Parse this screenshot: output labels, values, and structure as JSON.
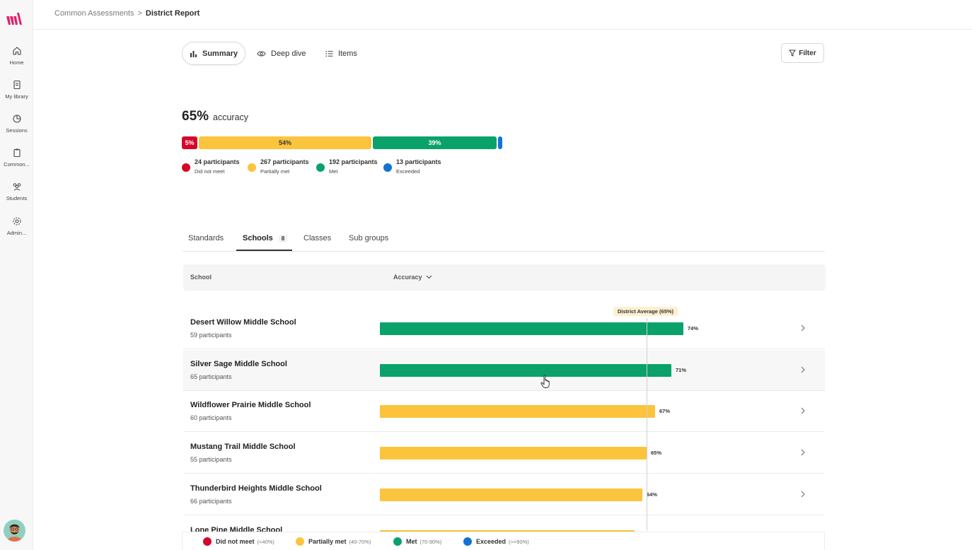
{
  "colors": {
    "did_not_meet": "#d6062b",
    "partially_met": "#fbc43c",
    "met": "#0aa26a",
    "exceeded": "#1173d4",
    "brand": "#e4206b"
  },
  "sidebar": {
    "items": [
      {
        "label": "Home",
        "icon": "home-icon"
      },
      {
        "label": "My library",
        "icon": "library-icon"
      },
      {
        "label": "Sessions",
        "icon": "sessions-icon"
      },
      {
        "label": "Common...",
        "icon": "clipboard-icon"
      },
      {
        "label": "Students",
        "icon": "students-icon"
      },
      {
        "label": "Admin...",
        "icon": "gear-icon"
      }
    ]
  },
  "breadcrumb": {
    "parent": "Common Assessments",
    "separator": ">",
    "current": "District Report"
  },
  "view_tabs": [
    {
      "label": "Summary",
      "icon": "bar-chart-icon",
      "active": true
    },
    {
      "label": "Deep dive",
      "icon": "eye-icon",
      "active": false
    },
    {
      "label": "Items",
      "icon": "list-icon",
      "active": false
    }
  ],
  "filter_label": "Filter",
  "accuracy": {
    "value": "65%",
    "label": "accuracy"
  },
  "distribution": [
    {
      "key": "did_not_meet",
      "percent": 5,
      "percent_label": "5%",
      "count_label": "24 participants",
      "category": "Did not meet"
    },
    {
      "key": "partially_met",
      "percent": 54,
      "percent_label": "54%",
      "count_label": "267 participants",
      "category": "Partially met"
    },
    {
      "key": "met",
      "percent": 39,
      "percent_label": "39%",
      "count_label": "192 participants",
      "category": "Met"
    },
    {
      "key": "exceeded",
      "percent": 2,
      "percent_label": "",
      "count_label": "13 participants",
      "category": "Exceeded"
    }
  ],
  "section_tabs": [
    {
      "label": "Standards",
      "active": false
    },
    {
      "label": "Schools",
      "active": true,
      "badge": "8"
    },
    {
      "label": "Classes",
      "active": false
    },
    {
      "label": "Sub groups",
      "active": false
    }
  ],
  "table": {
    "col_school": "School",
    "col_accuracy": "Accuracy",
    "district_average_label": "District Average (65%)",
    "district_average": 65,
    "rows": [
      {
        "name": "Desert Willow Middle School",
        "participants": "59 participants",
        "accuracy": 74,
        "accuracy_label": "74%",
        "level": "met"
      },
      {
        "name": "Silver Sage Middle School",
        "participants": "65 participants",
        "accuracy": 71,
        "accuracy_label": "71%",
        "level": "met"
      },
      {
        "name": "Wildflower Prairie Middle School",
        "participants": "60 participants",
        "accuracy": 67,
        "accuracy_label": "67%",
        "level": "partially_met"
      },
      {
        "name": "Mustang Trail Middle School",
        "participants": "55 participants",
        "accuracy": 65,
        "accuracy_label": "65%",
        "level": "partially_met"
      },
      {
        "name": "Thunderbird Heights Middle School",
        "participants": "66 participants",
        "accuracy": 64,
        "accuracy_label": "64%",
        "level": "partially_met"
      },
      {
        "name": "Lone Pine Middle School",
        "participants": "",
        "accuracy": 62,
        "accuracy_label": "",
        "level": "partially_met"
      }
    ]
  },
  "bottom_legend": [
    {
      "key": "did_not_meet",
      "label": "Did not meet",
      "range": "(<40%)"
    },
    {
      "key": "partially_met",
      "label": "Partially met",
      "range": "(40-70%)"
    },
    {
      "key": "met",
      "label": "Met",
      "range": "(70-90%)"
    },
    {
      "key": "exceeded",
      "label": "Exceeded",
      "range": "(>=90%)"
    }
  ]
}
